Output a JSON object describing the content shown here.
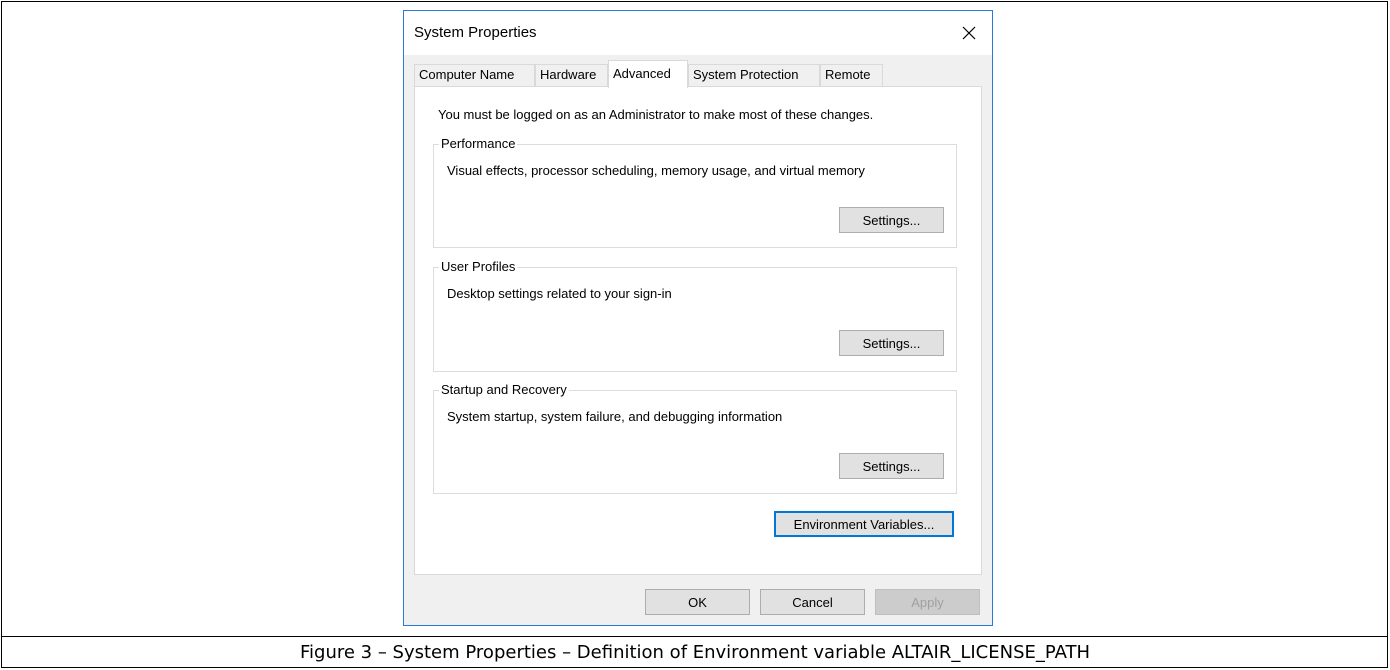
{
  "window": {
    "title": "System Properties"
  },
  "tabs": [
    {
      "label": "Computer Name",
      "active": false
    },
    {
      "label": "Hardware",
      "active": false
    },
    {
      "label": "Advanced",
      "active": true
    },
    {
      "label": "System Protection",
      "active": false
    },
    {
      "label": "Remote",
      "active": false
    }
  ],
  "advanced": {
    "admin_note": "You must be logged on as an Administrator to make most of these changes.",
    "performance": {
      "title": "Performance",
      "description": "Visual effects, processor scheduling, memory usage, and virtual memory",
      "button": "Settings..."
    },
    "user_profiles": {
      "title": "User Profiles",
      "description": "Desktop settings related to your sign-in",
      "button": "Settings..."
    },
    "startup_recovery": {
      "title": "Startup and Recovery",
      "description": "System startup, system failure, and debugging information",
      "button": "Settings..."
    },
    "env_button": "Environment Variables..."
  },
  "footer": {
    "ok": "OK",
    "cancel": "Cancel",
    "apply": "Apply"
  },
  "caption": "Figure 3 – System Properties – Definition of Environment variable ALTAIR_LICENSE_PATH",
  "icons": {
    "close": "close-icon"
  },
  "colors": {
    "window_border": "#2b79d7",
    "focus": "#0078d7",
    "dialog_bg": "#f0f0f0"
  }
}
